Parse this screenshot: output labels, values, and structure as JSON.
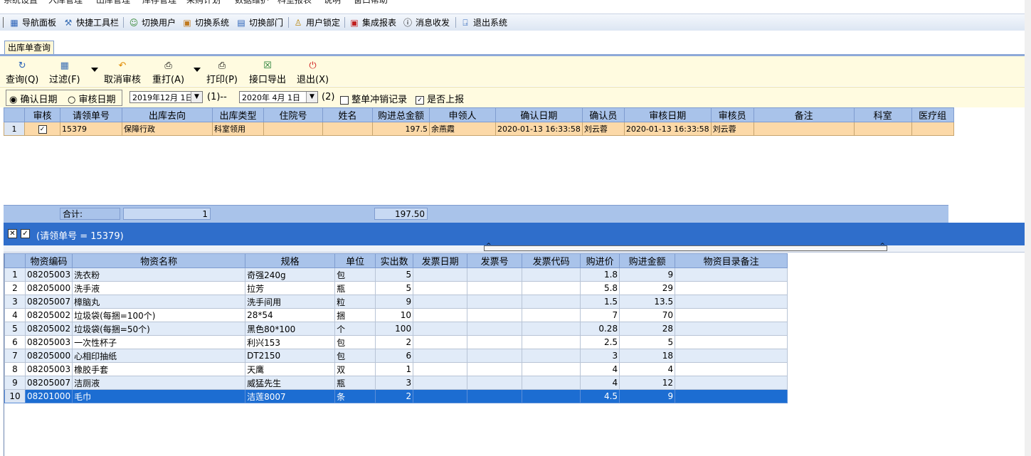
{
  "menu": {
    "items": [
      "系统设置",
      "入库管理",
      "出库管理",
      "库存管理",
      "采购计划",
      "数据维护",
      "科室报表",
      "说明",
      "窗口帮助"
    ]
  },
  "toolbar": {
    "items": [
      {
        "icon": "navigation-panel-icon",
        "label": "导航面板"
      },
      {
        "icon": "quick-toolbar-icon",
        "label": "快捷工具栏"
      },
      {
        "icon": "switch-user-icon",
        "label": "切换用户"
      },
      {
        "icon": "switch-system-icon",
        "label": "切换系统"
      },
      {
        "icon": "switch-department-icon",
        "label": "切换部门"
      },
      {
        "icon": "user-lock-icon",
        "label": "用户锁定"
      },
      {
        "icon": "integrated-report-icon",
        "label": "集成报表"
      },
      {
        "icon": "message-icon",
        "label": "消息收发"
      },
      {
        "icon": "exit-system-icon",
        "label": "退出系统"
      }
    ]
  },
  "tab": {
    "label": "出库单查询"
  },
  "actions": {
    "query": "查询(Q)",
    "filter": "过滤(F)",
    "cancel_audit": "取消审核",
    "reprint": "重打(A)",
    "print": "打印(P)",
    "export": "接口导出",
    "exit": "退出(X)"
  },
  "filter_bar": {
    "radio_confirm": "确认日期",
    "radio_audit": "审核日期",
    "date_from": "2019年12月 1日",
    "from_label": "(1)--",
    "date_to": "2020年 4月 1日",
    "to_label": "(2)",
    "whole_writeoff": "整单冲销记录",
    "report_flag": "是否上报"
  },
  "grid1": {
    "headers": [
      "",
      "审核",
      "请领单号",
      "出库去向",
      "出库类型",
      "住院号",
      "姓名",
      "购进总金额",
      "申领人",
      "确认日期",
      "确认员",
      "审核日期",
      "审核员",
      "备注",
      "科室",
      "医疗组"
    ],
    "row": {
      "num": "1",
      "req_no": "15379",
      "dest": "保障行政",
      "type": "科室领用",
      "inpatient": "",
      "name": "",
      "total": "197.5",
      "applicant": "余燕霞",
      "confirm_date": "2020-01-13 16:33:58",
      "confirmer": "刘云蓉",
      "audit_date": "2020-01-13 16:33:58",
      "auditor": "刘云蓉",
      "remark": "",
      "dept": "",
      "group": ""
    },
    "summary": {
      "label": "合计:",
      "count": "1",
      "total": "197.50"
    }
  },
  "filter_expr": "(请领单号 = 15379)",
  "grid2": {
    "headers": [
      "",
      "物资编码",
      "物资名称",
      "规格",
      "单位",
      "实出数",
      "发票日期",
      "发票号",
      "发票代码",
      "购进价",
      "购进金额",
      "物资目录备注"
    ],
    "rows": [
      {
        "n": "1",
        "code": "08205003",
        "name": "洗衣粉",
        "spec": "奇强240g",
        "unit": "包",
        "qty": "5",
        "price": "1.8",
        "amount": "9"
      },
      {
        "n": "2",
        "code": "08205000",
        "name": "洗手液",
        "spec": "拉芳",
        "unit": "瓶",
        "qty": "5",
        "price": "5.8",
        "amount": "29"
      },
      {
        "n": "3",
        "code": "08205007",
        "name": "樟脑丸",
        "spec": "洗手间用",
        "unit": "粒",
        "qty": "9",
        "price": "1.5",
        "amount": "13.5"
      },
      {
        "n": "4",
        "code": "08205002",
        "name": "垃圾袋(每捆=100个)",
        "spec": "28*54",
        "unit": "捆",
        "qty": "10",
        "price": "7",
        "amount": "70"
      },
      {
        "n": "5",
        "code": "08205002",
        "name": "垃圾袋(每捆=50个)",
        "spec": "黑色80*100",
        "unit": "个",
        "qty": "100",
        "price": "0.28",
        "amount": "28"
      },
      {
        "n": "6",
        "code": "08205003",
        "name": "一次性杯子",
        "spec": "利兴153",
        "unit": "包",
        "qty": "2",
        "price": "2.5",
        "amount": "5"
      },
      {
        "n": "7",
        "code": "08205000",
        "name": "心相印抽纸",
        "spec": "DT2150",
        "unit": "包",
        "qty": "6",
        "price": "3",
        "amount": "18"
      },
      {
        "n": "8",
        "code": "08205003",
        "name": "橡胶手套",
        "spec": "天鹰",
        "unit": "双",
        "qty": "1",
        "price": "4",
        "amount": "4"
      },
      {
        "n": "9",
        "code": "08205007",
        "name": "洁厕液",
        "spec": "威猛先生",
        "unit": "瓶",
        "qty": "3",
        "price": "4",
        "amount": "12"
      },
      {
        "n": "10",
        "code": "08201000",
        "name": "毛巾",
        "spec": "洁莲8007",
        "unit": "条",
        "qty": "2",
        "price": "4.5",
        "amount": "9"
      }
    ]
  },
  "colors": {
    "header": "#a9c3ea",
    "selected_row": "#1c6dd2",
    "highlight_row": "#fcd9a8",
    "filter_bar": "#2f6ecb"
  }
}
